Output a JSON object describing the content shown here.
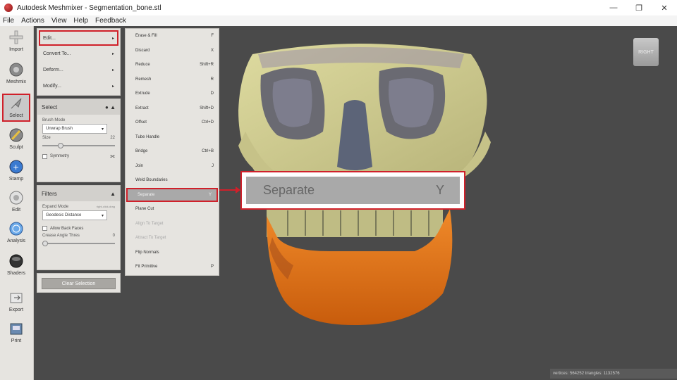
{
  "window": {
    "title": "Autodesk Meshmixer - Segmentation_bone.stl",
    "controls": [
      "—",
      "❐",
      "✕"
    ]
  },
  "menubar": [
    "File",
    "Actions",
    "View",
    "Help",
    "Feedback"
  ],
  "toolbar": [
    {
      "label": "Import",
      "icon": "plus-icon"
    },
    {
      "label": "Meshmix",
      "icon": "meshmix-icon"
    },
    {
      "label": "Select",
      "icon": "select-arrow-icon",
      "selected": true
    },
    {
      "label": "Sculpt",
      "icon": "brush-icon"
    },
    {
      "label": "Stamp",
      "icon": "stamp-icon"
    },
    {
      "label": "Edit",
      "icon": "edit-icon"
    },
    {
      "label": "Analysis",
      "icon": "analysis-icon"
    },
    {
      "label": "Shaders",
      "icon": "shaders-icon"
    },
    {
      "label": "Export",
      "icon": "export-icon"
    },
    {
      "label": "Print",
      "icon": "print-icon"
    }
  ],
  "actions_menu": [
    {
      "label": "Edit...",
      "arrow": "▸"
    },
    {
      "label": "Convert To...",
      "arrow": "▸"
    },
    {
      "label": "Deform...",
      "arrow": "▸"
    },
    {
      "label": "Modify...",
      "arrow": "▸"
    }
  ],
  "select_panel": {
    "title": "Select",
    "brush_mode_label": "Brush Mode",
    "brush_mode_value": "Unwrap Brush",
    "size_label": "Size",
    "size_value": "22",
    "symmetry_label": "Symmetry"
  },
  "filters_panel": {
    "title": "Filters",
    "expand_mode_label": "Expand Mode",
    "expand_mode_hint": "right-click-drag",
    "expand_mode_value": "Geodesic Distance",
    "allow_back_faces_label": "Allow Back Faces",
    "crease_angle_label": "Crease Angle Thres",
    "crease_angle_value": "0"
  },
  "clear_selection_label": "Clear Selection",
  "edit_submenu": [
    {
      "label": "Erase & Fill",
      "shortcut": "F"
    },
    {
      "label": "Discard",
      "shortcut": "X"
    },
    {
      "label": "Reduce",
      "shortcut": "Shift+R"
    },
    {
      "label": "Remesh",
      "shortcut": "R"
    },
    {
      "label": "Extrude",
      "shortcut": "D"
    },
    {
      "label": "Extract",
      "shortcut": "Shift+D"
    },
    {
      "label": "Offset",
      "shortcut": "Ctrl+D"
    },
    {
      "label": "Tube Handle",
      "shortcut": ""
    },
    {
      "label": "Bridge",
      "shortcut": "Ctrl+B"
    },
    {
      "label": "Join",
      "shortcut": "J"
    },
    {
      "label": "Weld Boundaries",
      "shortcut": ""
    },
    {
      "label": "Separate",
      "shortcut": "Y",
      "highlight": true
    },
    {
      "label": "Plane Cut",
      "shortcut": ""
    },
    {
      "label": "Align To Target",
      "shortcut": "",
      "disabled": true
    },
    {
      "label": "Attract To Target",
      "shortcut": "",
      "disabled": true
    },
    {
      "label": "Flip Normals",
      "shortcut": ""
    },
    {
      "label": "Fit Primitive",
      "shortcut": "P"
    }
  ],
  "callout": {
    "label": "Separate",
    "shortcut": "Y"
  },
  "view_cube_label": "RIGHT",
  "status": "vertices: 564252 triangles: 1132576",
  "colors": {
    "accent_red": "#d0202a",
    "bone": "#cfcc8e",
    "jaw_orange": "#e0721a",
    "viewport_bg": "#4a4a4a"
  }
}
